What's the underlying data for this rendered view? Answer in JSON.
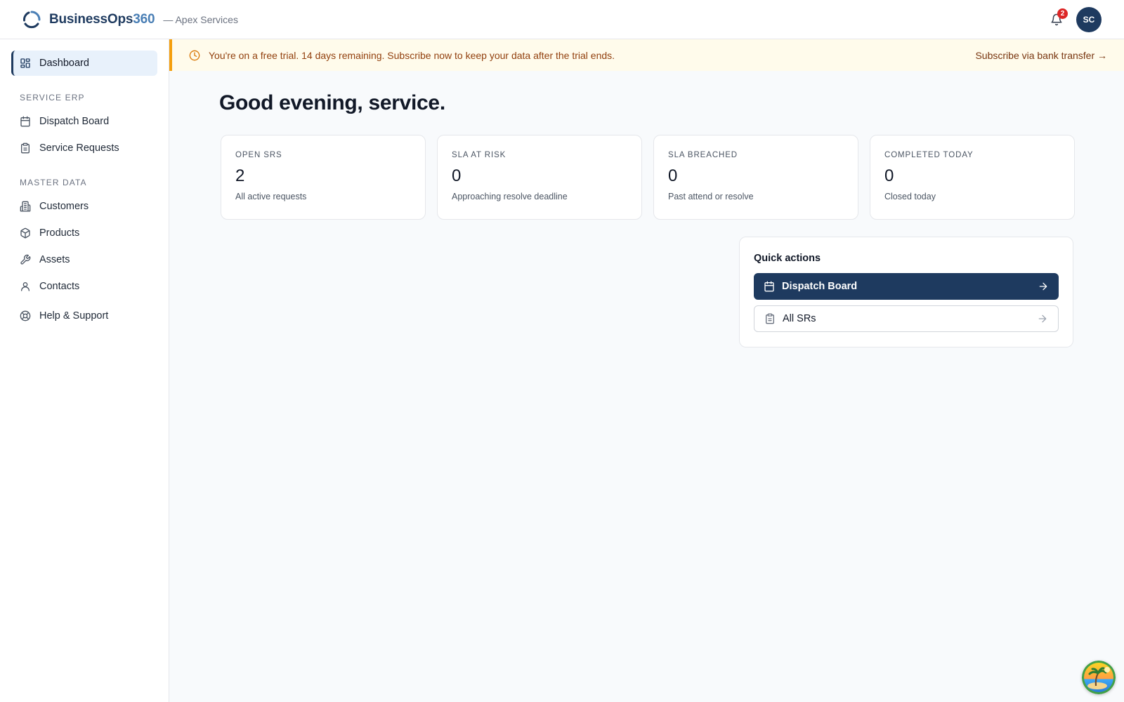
{
  "header": {
    "brand_name": "BusinessOps",
    "brand_accent": "360",
    "org_label": "— Apex Services",
    "notification_count": "2",
    "avatar_initials": "SC"
  },
  "sidebar": {
    "dashboard_label": "Dashboard",
    "sections": [
      {
        "title": "SERVICE ERP",
        "items": [
          {
            "label": "Dispatch Board",
            "icon": "calendar-icon"
          },
          {
            "label": "Service Requests",
            "icon": "clipboard-icon"
          }
        ]
      },
      {
        "title": "MASTER DATA",
        "items": [
          {
            "label": "Customers",
            "icon": "building-icon"
          },
          {
            "label": "Products",
            "icon": "box-icon"
          },
          {
            "label": "Assets",
            "icon": "wrench-icon"
          },
          {
            "label": "Contacts",
            "icon": "user-icon"
          }
        ]
      }
    ],
    "help_label": "Help & Support"
  },
  "banner": {
    "text": "You're on a free trial. 14 days remaining. Subscribe now to keep your data after the trial ends.",
    "link": "Subscribe via bank transfer →"
  },
  "main": {
    "greeting": "Good evening, service.",
    "stats": [
      {
        "label": "OPEN SRS",
        "value": "2",
        "desc": "All active requests"
      },
      {
        "label": "SLA AT RISK",
        "value": "0",
        "desc": "Approaching resolve deadline"
      },
      {
        "label": "SLA BREACHED",
        "value": "0",
        "desc": "Past attend or resolve"
      },
      {
        "label": "COMPLETED TODAY",
        "value": "0",
        "desc": "Closed today"
      }
    ],
    "quick_actions": {
      "title": "Quick actions",
      "primary_label": "Dispatch Board",
      "secondary_label": "All SRs"
    }
  },
  "colors": {
    "brand_navy": "#1e3a5f",
    "brand_accent": "#4a7fb5",
    "banner_bg": "#fffbeb",
    "banner_border": "#f59e0b",
    "badge_red": "#dc2626"
  }
}
